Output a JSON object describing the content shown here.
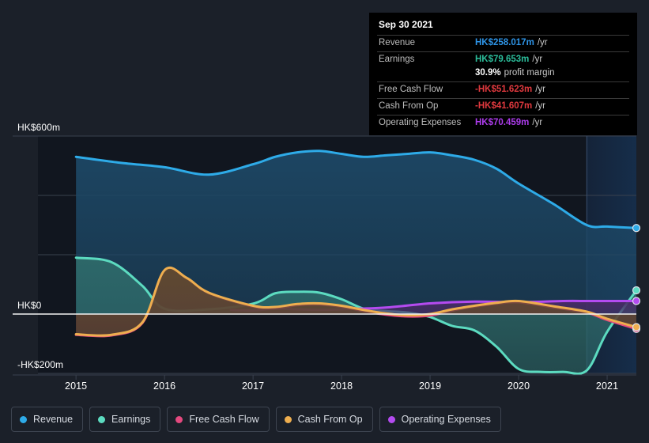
{
  "chart_data": {
    "type": "area",
    "title": "",
    "xlabel": "",
    "ylabel": "",
    "currency": "HK$",
    "x_tick_labels": [
      "2015",
      "2016",
      "2017",
      "2018",
      "2019",
      "2020",
      "2021"
    ],
    "y_tick_labels": [
      "HK$600m",
      "HK$0",
      "-HK$200m"
    ],
    "ylim": [
      -200,
      600
    ],
    "xlim": [
      2014.57,
      2021.33
    ],
    "grid": true,
    "gridlines_y": [
      600,
      400,
      200,
      0,
      -200
    ],
    "zero_line": 0,
    "legend_position": "bottom",
    "forecast_start": "2020.77",
    "series": [
      {
        "name": "Revenue",
        "color": "#2eabe8",
        "fill": "#1d4866",
        "x": [
          2015.0,
          2015.5,
          2016.0,
          2016.5,
          2017.0,
          2017.25,
          2017.5,
          2017.75,
          2018.0,
          2018.25,
          2018.5,
          2018.75,
          2019.0,
          2019.25,
          2019.5,
          2019.75,
          2020.0,
          2020.4,
          2020.77,
          2021.0,
          2021.33
        ],
        "values": [
          530,
          510,
          495,
          470,
          505,
          530,
          545,
          550,
          540,
          530,
          535,
          540,
          545,
          535,
          520,
          490,
          440,
          370,
          300,
          295,
          290
        ],
        "endpoint": 258.017
      },
      {
        "name": "Earnings",
        "color": "#5cdbc0",
        "fill": "#2e6a6a",
        "x": [
          2015.0,
          2015.4,
          2015.75,
          2016.0,
          2016.5,
          2017.0,
          2017.25,
          2017.5,
          2017.75,
          2018.0,
          2018.25,
          2018.5,
          2018.75,
          2019.0,
          2019.25,
          2019.5,
          2019.75,
          2020.0,
          2020.25,
          2020.5,
          2020.77,
          2021.0,
          2021.33
        ],
        "values": [
          190,
          175,
          95,
          18,
          16,
          35,
          70,
          75,
          72,
          50,
          18,
          10,
          5,
          -10,
          -40,
          -55,
          -110,
          -185,
          -195,
          -195,
          -190,
          -60,
          80
        ],
        "endpoint": 79.653
      },
      {
        "name": "Free Cash Flow",
        "color": "#e4497f",
        "fill": "#5e3040",
        "x": [
          2015.0,
          2015.4,
          2015.75,
          2016.0,
          2016.25,
          2016.5,
          2017.0,
          2017.25,
          2017.5,
          2017.75,
          2018.0,
          2018.25,
          2018.5,
          2018.75,
          2019.0,
          2019.25,
          2019.5,
          2019.75,
          2020.0,
          2020.4,
          2020.77,
          2021.0,
          2021.33
        ],
        "values": [
          -70,
          -72,
          -30,
          145,
          120,
          70,
          25,
          20,
          30,
          32,
          25,
          10,
          -2,
          -8,
          -5,
          12,
          25,
          35,
          40,
          22,
          5,
          -20,
          -50
        ],
        "endpoint": -51.623
      },
      {
        "name": "Cash From Op",
        "color": "#eeae4f",
        "fill": "#5e4a30",
        "x": [
          2015.0,
          2015.4,
          2015.75,
          2016.0,
          2016.25,
          2016.5,
          2017.0,
          2017.25,
          2017.5,
          2017.75,
          2018.0,
          2018.25,
          2018.5,
          2018.75,
          2019.0,
          2019.25,
          2019.5,
          2019.75,
          2020.0,
          2020.4,
          2020.77,
          2021.0,
          2021.33
        ],
        "values": [
          -68,
          -70,
          -28,
          148,
          122,
          72,
          28,
          24,
          34,
          36,
          28,
          14,
          2,
          -4,
          0,
          16,
          28,
          38,
          44,
          26,
          8,
          -16,
          -44
        ],
        "endpoint": -41.607
      },
      {
        "name": "Operating Expenses",
        "color": "#b44bf0",
        "fill": "#4a2a66",
        "x": [
          2016.75,
          2017.0,
          2017.25,
          2017.5,
          2017.75,
          2018.0,
          2018.5,
          2019.0,
          2019.5,
          2020.0,
          2020.5,
          2020.77,
          2021.0,
          2021.33
        ],
        "values": [
          14,
          12,
          18,
          16,
          14,
          16,
          22,
          36,
          42,
          40,
          44,
          44,
          44,
          44
        ],
        "endpoint": 70.459
      }
    ]
  },
  "tooltip": {
    "date": "Sep 30 2021",
    "rows": [
      {
        "key": "Revenue",
        "value": "HK$258.017m",
        "unit": "/yr",
        "color": "#2e95e8"
      },
      {
        "key": "Earnings",
        "value": "HK$79.653m",
        "unit": "/yr",
        "color": "#2bbd9a"
      },
      {
        "key": "",
        "value": "30.9%",
        "unit": "profit margin",
        "color": "#ffffff"
      },
      {
        "key": "Free Cash Flow",
        "value": "-HK$51.623m",
        "unit": "/yr",
        "color": "#e0393e"
      },
      {
        "key": "Cash From Op",
        "value": "-HK$41.607m",
        "unit": "/yr",
        "color": "#e0393e"
      },
      {
        "key": "Operating Expenses",
        "value": "HK$70.459m",
        "unit": "/yr",
        "color": "#ac3ceb"
      }
    ]
  },
  "legend": {
    "items": [
      {
        "label": "Revenue",
        "color": "#2eabe8"
      },
      {
        "label": "Earnings",
        "color": "#5cdbc0"
      },
      {
        "label": "Free Cash Flow",
        "color": "#e4497f"
      },
      {
        "label": "Cash From Op",
        "color": "#eeae4f"
      },
      {
        "label": "Operating Expenses",
        "color": "#b44bf0"
      }
    ]
  },
  "axes": {
    "y_top": "HK$600m",
    "y_zero": "HK$0",
    "y_bottom": "-HK$200m",
    "x_ticks": [
      "2015",
      "2016",
      "2017",
      "2018",
      "2019",
      "2020",
      "2021"
    ]
  }
}
